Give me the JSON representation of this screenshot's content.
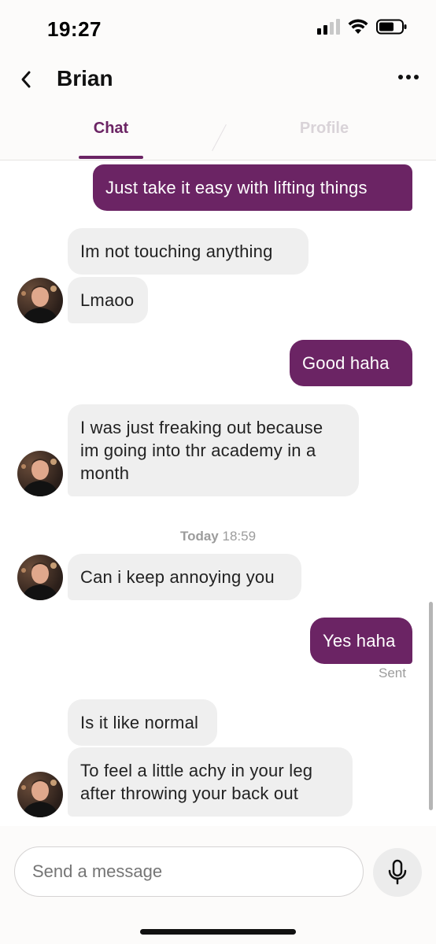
{
  "status_bar": {
    "time": "19:27",
    "icons": [
      "cellular-signal-icon",
      "wifi-icon",
      "battery-icon"
    ]
  },
  "header": {
    "back_icon": "chevron-left-icon",
    "contact_name": "Brian",
    "more_icon": "more-horizontal-icon",
    "tabs": [
      {
        "label": "Chat",
        "active": true
      },
      {
        "label": "Profile",
        "active": false
      }
    ]
  },
  "messages": [
    {
      "direction": "out",
      "text": "Just take it easy with lifting things"
    },
    {
      "direction": "in",
      "text": "Im not touching anything"
    },
    {
      "direction": "in",
      "text": "Lmaoo"
    },
    {
      "direction": "out",
      "text": "Good haha"
    },
    {
      "direction": "in",
      "text": "I was just freaking out because im going into thr academy in a month"
    },
    {
      "direction": "in",
      "text": "Can i keep annoying you"
    },
    {
      "direction": "out",
      "text": "Yes haha"
    },
    {
      "direction": "in",
      "text": "Is it like normal"
    },
    {
      "direction": "in",
      "text": "To feel a little achy in your leg after throwing your back out"
    }
  ],
  "timestamp_divider": {
    "day": "Today",
    "time": "18:59"
  },
  "sent_status": "Sent",
  "composer": {
    "placeholder": "Send a message",
    "mic_icon": "microphone-icon"
  },
  "colors": {
    "accent": "#6b2464",
    "incoming_bubble": "#efefef",
    "outgoing_text": "#ffffff"
  }
}
